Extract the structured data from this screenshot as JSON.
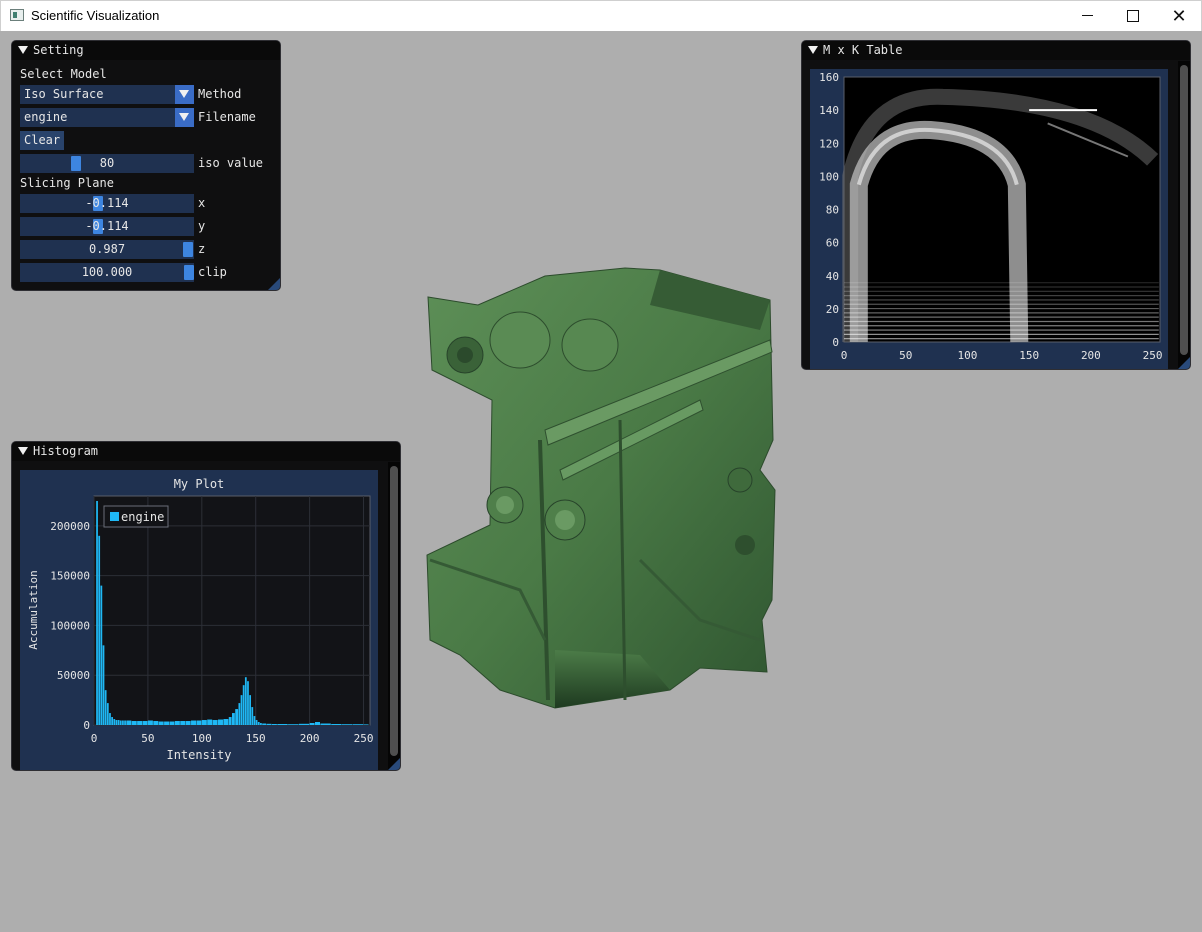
{
  "window": {
    "title": "Scientific Visualization"
  },
  "colors": {
    "accent": "#3d85e0",
    "frame": "#1f3150",
    "histogram_bar": "#1fb8f5",
    "model": "#4d7c49",
    "background": "#aeaeae"
  },
  "setting": {
    "title": "Setting",
    "select_model_label": "Select Model",
    "method_value": "Iso Surface",
    "method_label": "Method",
    "filename_value": "engine",
    "filename_label": "Filename",
    "clear_label": "Clear",
    "iso_value": "80",
    "iso_label": "iso value",
    "iso_fraction": 0.31,
    "slicing_plane_label": "Slicing Plane",
    "sliders": [
      {
        "value": "-0.114",
        "label": "x",
        "fraction": 0.443
      },
      {
        "value": "-0.114",
        "label": "y",
        "fraction": 0.443
      },
      {
        "value": "0.987",
        "label": "z",
        "fraction": 0.994
      },
      {
        "value": "100.000",
        "label": "clip",
        "fraction": 1.0
      }
    ]
  },
  "mk_table": {
    "title": "M x K Table",
    "x_ticks": [
      "0",
      "50",
      "100",
      "150",
      "200",
      "250"
    ],
    "y_ticks": [
      "0",
      "20",
      "40",
      "60",
      "80",
      "100",
      "120",
      "140",
      "160"
    ]
  },
  "histogram": {
    "title": "Histogram",
    "legend_label": "engine"
  },
  "chart_data": {
    "type": "bar",
    "title": "My Plot",
    "xlabel": "Intensity",
    "ylabel": "Accumulation",
    "xlim": [
      0,
      256
    ],
    "ylim": [
      0,
      230000
    ],
    "x_ticks": [
      "0",
      "50",
      "100",
      "150",
      "200",
      "250"
    ],
    "y_ticks": [
      "0",
      "50000",
      "100000",
      "150000",
      "200000"
    ],
    "legend": "top-left",
    "series": [
      {
        "name": "engine",
        "x": [
          0,
          2,
          4,
          6,
          8,
          10,
          12,
          14,
          16,
          18,
          20,
          22,
          24,
          26,
          28,
          30,
          35,
          40,
          45,
          50,
          55,
          60,
          65,
          70,
          75,
          80,
          85,
          90,
          95,
          100,
          105,
          110,
          115,
          120,
          125,
          128,
          131,
          134,
          136,
          138,
          140,
          142,
          144,
          146,
          148,
          150,
          152,
          154,
          156,
          160,
          165,
          170,
          180,
          190,
          200,
          205,
          210,
          220,
          230,
          240,
          250,
          255
        ],
        "values": [
          0,
          225000,
          190000,
          140000,
          80000,
          35000,
          22000,
          12000,
          8000,
          6000,
          5000,
          5000,
          4500,
          4500,
          4500,
          4500,
          4000,
          4000,
          4000,
          4500,
          4000,
          3500,
          3500,
          3500,
          4000,
          4000,
          4000,
          4500,
          4500,
          5000,
          5500,
          5000,
          5500,
          6000,
          8000,
          12000,
          16000,
          22000,
          30000,
          40000,
          48000,
          44000,
          30000,
          18000,
          9000,
          5000,
          3000,
          2000,
          1500,
          1200,
          1000,
          1000,
          800,
          1200,
          2000,
          3000,
          1500,
          1000,
          800,
          800,
          600,
          0
        ]
      }
    ]
  }
}
